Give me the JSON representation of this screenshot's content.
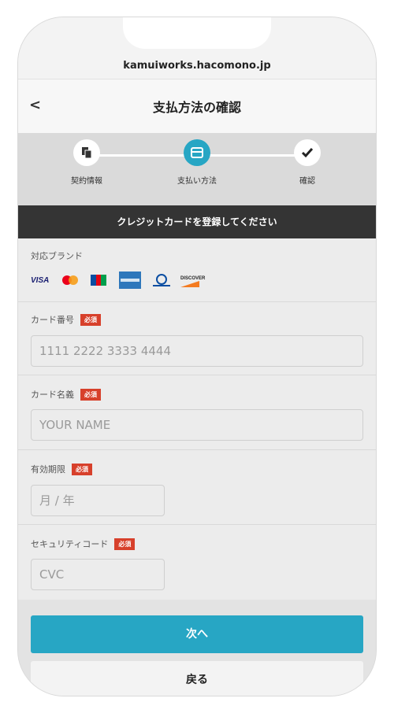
{
  "browser": {
    "url": "kamuiworks.hacomono.jp"
  },
  "nav": {
    "back": "<",
    "title": "支払方法の確認"
  },
  "steps": [
    {
      "label": "契約情報",
      "icon": "documents-icon"
    },
    {
      "label": "支払い方法",
      "icon": "card-icon"
    },
    {
      "label": "確認",
      "icon": "check-icon"
    }
  ],
  "banner": "クレジットカードを登録してください",
  "brands": {
    "label": "対応ブランド",
    "items": [
      "VISA",
      "MC",
      "JCB",
      "AMERICAN EXPRESS",
      "Diners Club",
      "DISCOVER"
    ]
  },
  "required_label": "必須",
  "card_number": {
    "label": "カード番号",
    "placeholder": "1111 2222 3333 4444"
  },
  "card_name": {
    "label": "カード名義",
    "placeholder": "YOUR NAME"
  },
  "expiry": {
    "label": "有効期限",
    "placeholder": "月 / 年"
  },
  "cvc": {
    "label": "セキュリティコード",
    "placeholder": "CVC"
  },
  "buttons": {
    "next": "次へ",
    "back": "戻る"
  },
  "colors": {
    "accent": "#27a6c4",
    "required": "#d7402b",
    "banner": "#343434"
  }
}
